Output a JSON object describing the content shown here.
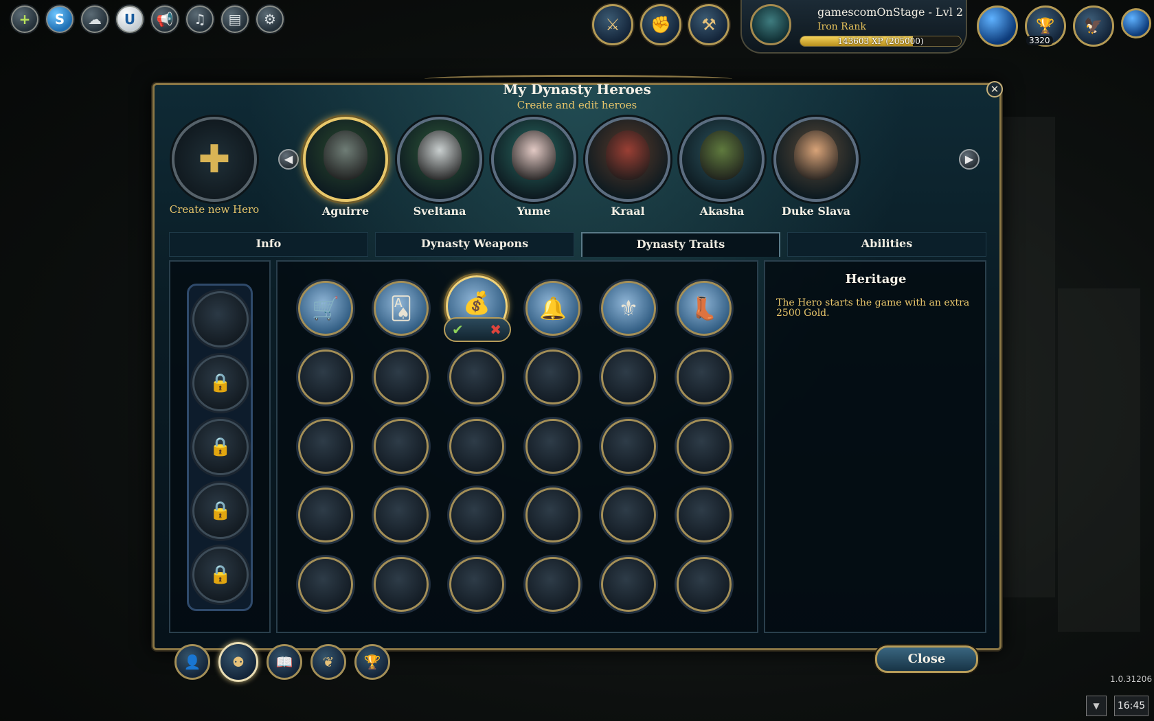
{
  "topbar": {
    "left_buttons": [
      {
        "name": "add-friend-icon",
        "glyph": "+"
      },
      {
        "name": "skype-icon",
        "glyph": "S"
      },
      {
        "name": "chat-icon",
        "glyph": "☁"
      },
      {
        "name": "uplay-icon",
        "glyph": "U"
      },
      {
        "name": "announce-icon",
        "glyph": "📢"
      },
      {
        "name": "music-icon",
        "glyph": "♫"
      },
      {
        "name": "notes-icon",
        "glyph": "▤"
      },
      {
        "name": "settings-icon",
        "glyph": "⚙"
      }
    ],
    "mid_buttons": [
      {
        "name": "heroes-icon",
        "glyph": "⚔"
      },
      {
        "name": "skills-icon",
        "glyph": "✊"
      },
      {
        "name": "battle-icon",
        "glyph": "⚒"
      }
    ],
    "profile": {
      "name": "gamescomOnStage - Lvl 2",
      "rank": "Iron Rank",
      "xp_text": "143603 XP (205000)",
      "xp_fraction": 0.7
    },
    "right_buttons": [
      {
        "name": "world-globe-icon",
        "glyph": ""
      },
      {
        "name": "treasury-icon",
        "glyph": "🏆"
      },
      {
        "name": "griffin-shop-icon",
        "glyph": "🦅"
      }
    ],
    "gold_count": "3320"
  },
  "dialog": {
    "title": "My Dynasty Heroes",
    "subtitle": "Create and edit heroes",
    "close_glyph": "✕",
    "create_hero_label": "Create new Hero",
    "create_hero_glyph": "✚",
    "prev_glyph": "◀",
    "next_glyph": "▶",
    "heroes": [
      {
        "name": "Aguirre",
        "selected": true,
        "bg": "#2b4a2e",
        "face": "#6f7d76"
      },
      {
        "name": "Sveltana",
        "selected": false,
        "bg": "#2f5a3a",
        "face": "#c9cfcf"
      },
      {
        "name": "Yume",
        "selected": false,
        "bg": "#2a6a62",
        "face": "#e2c9c4"
      },
      {
        "name": "Kraal",
        "selected": false,
        "bg": "#5a3a2a",
        "face": "#9a3f34"
      },
      {
        "name": "Akasha",
        "selected": false,
        "bg": "#2d5560",
        "face": "#5f7a3e"
      },
      {
        "name": "Duke Slava",
        "selected": false,
        "bg": "#5a4a3a",
        "face": "#d8a378"
      }
    ],
    "tabs": [
      {
        "label": "Info",
        "active": false
      },
      {
        "label": "Dynasty Weapons",
        "active": false
      },
      {
        "label": "Dynasty Traits",
        "active": true
      },
      {
        "label": "Abilities",
        "active": false
      }
    ],
    "trait_icons": [
      {
        "name": "supply-wagon-icon",
        "glyph": "🛒"
      },
      {
        "name": "cards-icon",
        "glyph": "🂡"
      },
      {
        "name": "gold-sacks-icon",
        "glyph": "💰"
      },
      {
        "name": "bell-tools-icon",
        "glyph": "🔔"
      },
      {
        "name": "banner-icon",
        "glyph": "⚜"
      },
      {
        "name": "boot-icon",
        "glyph": "👢"
      }
    ],
    "confirm_glyph": "✔",
    "cancel_glyph": "✖",
    "lock_glyph": "🔒",
    "description": {
      "title": "Heritage",
      "text": "The Hero starts the game with an extra 2500 Gold."
    },
    "bottom_tabs": [
      {
        "name": "hero-profile-icon",
        "glyph": "👤",
        "active": false
      },
      {
        "name": "dynasty-heroes-icon",
        "glyph": "⚉",
        "active": true
      },
      {
        "name": "dynasty-book-icon",
        "glyph": "📖",
        "active": false
      },
      {
        "name": "laurel-icon",
        "glyph": "❦",
        "active": false
      },
      {
        "name": "trophy-hero-icon",
        "glyph": "🏆",
        "active": false
      }
    ],
    "close_label": "Close"
  },
  "footer": {
    "version": "1.0.31206",
    "dropdown_glyph": "▼",
    "time": "16:45"
  },
  "colors": {
    "gold": "#e6c46a",
    "frame": "#8b7745",
    "panel": "#06121a"
  }
}
